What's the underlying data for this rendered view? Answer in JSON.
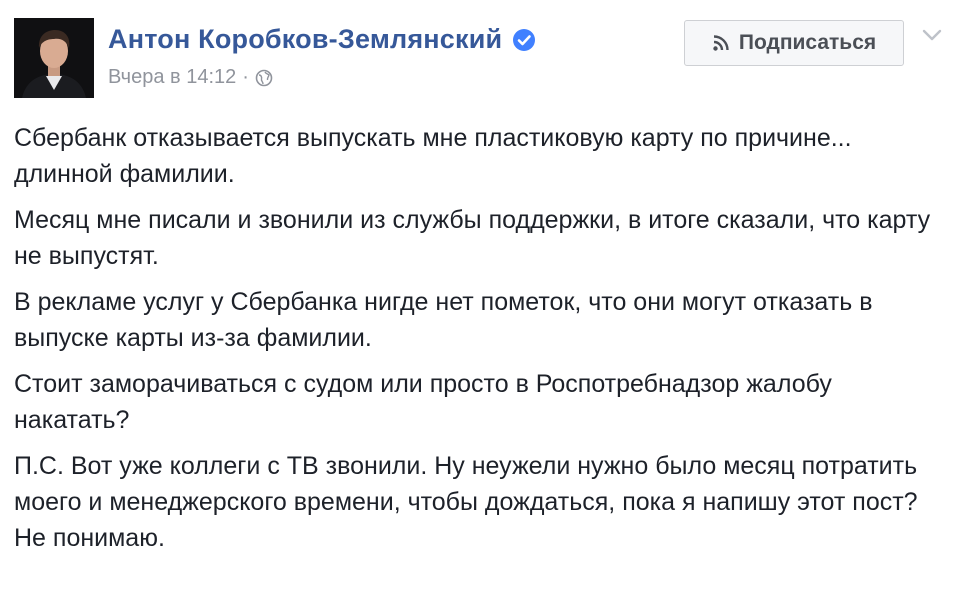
{
  "post": {
    "author_name": "Антон Коробков-Землянский",
    "timestamp": "Вчера в 14:12",
    "separator": "·",
    "subscribe_label": "Подписаться",
    "paragraphs": [
      "Сбербанк отказывается выпускать мне пластиковую карту по причине... длинной фамилии.",
      "Месяц мне писали и звонили из службы поддержки, в итоге сказали, что карту не выпустят.",
      "В рекламе услуг у Сбербанка нигде нет пометок, что они могут отказать в выпуске карты из-за фамилии.",
      "Стоит заморачиваться с судом или просто в Роспотребнадзор жалобу накатать?",
      "П.С. Вот уже коллеги с ТВ звонили. Ну неужели нужно было месяц потратить моего и менеджерского времени, чтобы дождаться, пока я напишу этот пост? Не понимаю."
    ]
  },
  "icons": {
    "verified": "verified-badge-icon",
    "audience": "globe-icon",
    "subscribe": "rss-icon",
    "menu": "chevron-down-icon"
  },
  "colors": {
    "author_link": "#365899",
    "meta_text": "#90949c",
    "body_text": "#1d2129",
    "verified_badge": "#4080ff",
    "button_bg": "#f6f7f9",
    "button_border": "#ced0d4"
  }
}
